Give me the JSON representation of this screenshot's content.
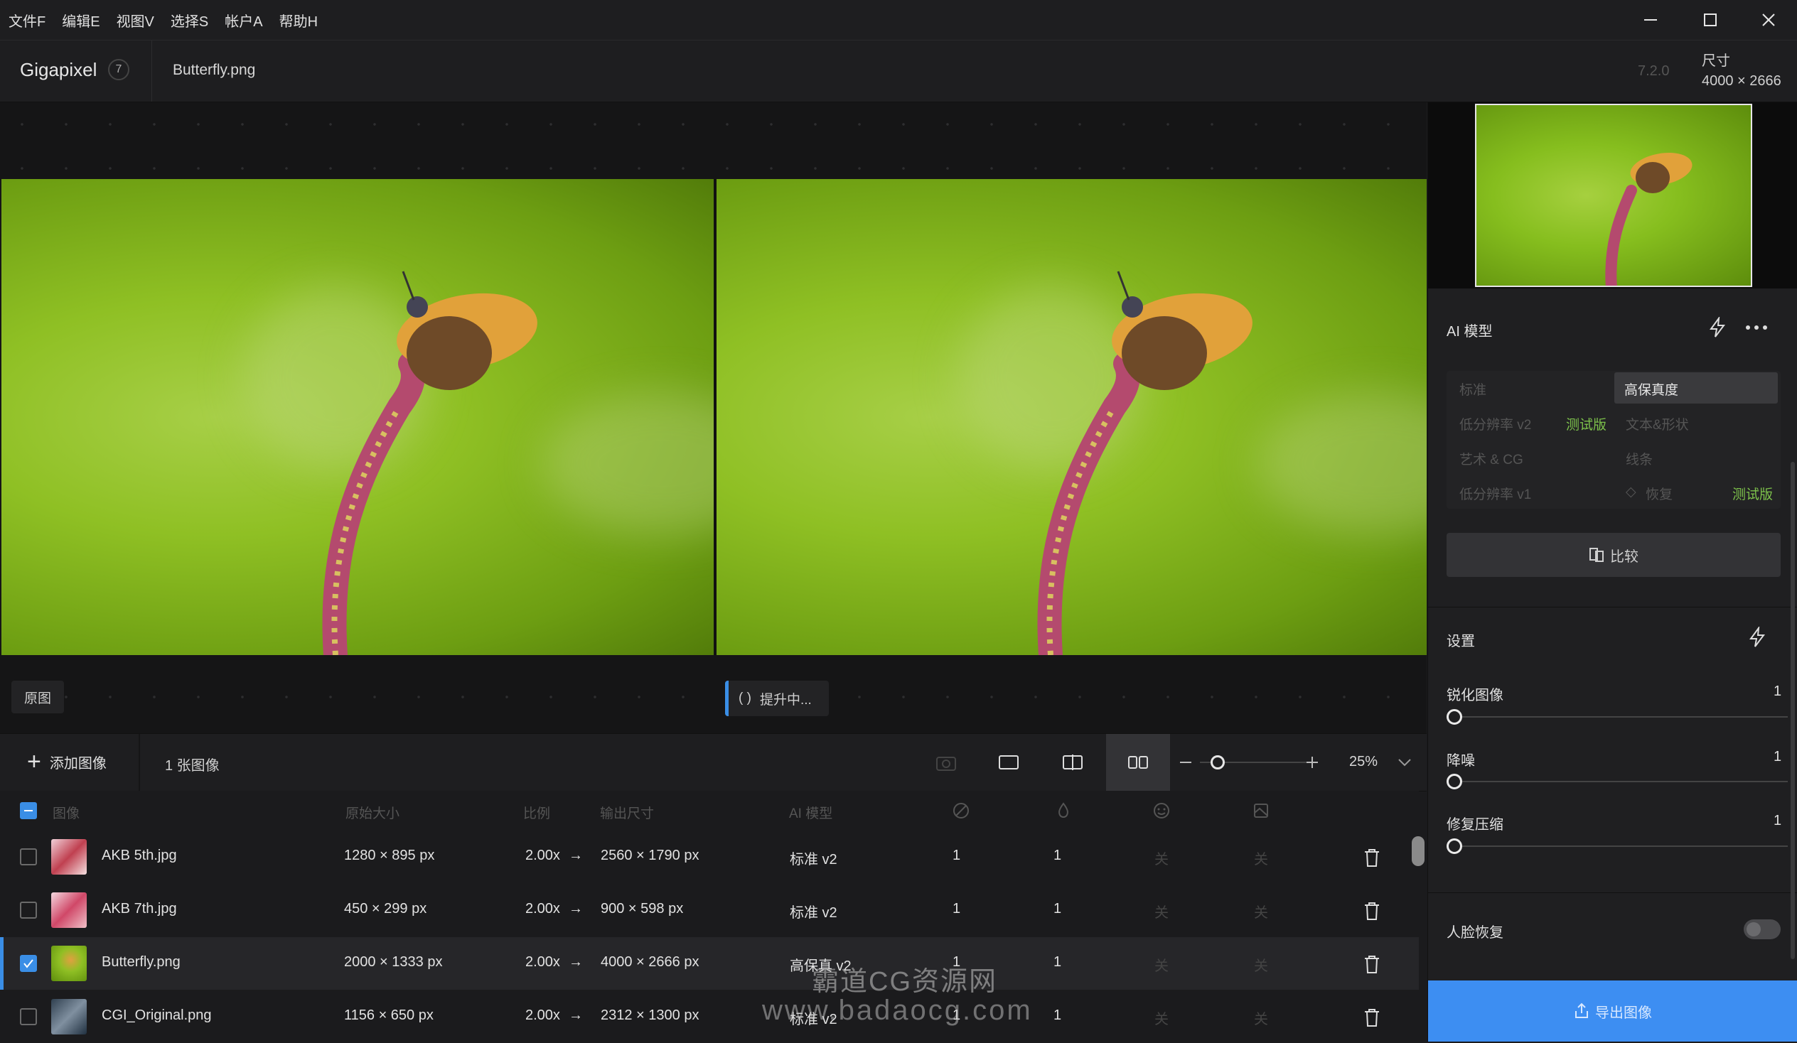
{
  "menubar": {
    "items": [
      "文件F",
      "编辑E",
      "视图V",
      "选择S",
      "帐户A",
      "帮助H"
    ]
  },
  "header": {
    "app_name": "Gigapixel",
    "badge": "7",
    "file_name": "Butterfly.png",
    "version": "7.2.0",
    "size_label": "尺寸",
    "size_value": "4000 × 2666"
  },
  "preview": {
    "original_label": "原图",
    "processing_label": "提升中..."
  },
  "toolbar": {
    "add_image": "添加图像",
    "image_count": "1 张图像",
    "zoom": "25%",
    "zoom_level": 0.1
  },
  "table": {
    "headers": {
      "image": "图像",
      "original_size": "原始大小",
      "scale": "比例",
      "output_size": "输出尺寸",
      "ai_model": "AI 模型"
    },
    "rows": [
      {
        "name": "AKB 5th.jpg",
        "original": "1280 × 895 px",
        "scale": "2.00x",
        "output": "2560 × 1790 px",
        "model": "标准 v2",
        "c1": "1",
        "c2": "1",
        "c3": "关",
        "c4": "关",
        "checked": false
      },
      {
        "name": "AKB 7th.jpg",
        "original": "450 × 299 px",
        "scale": "2.00x",
        "output": "900 × 598 px",
        "model": "标准 v2",
        "c1": "1",
        "c2": "1",
        "c3": "关",
        "c4": "关",
        "checked": false
      },
      {
        "name": "Butterfly.png",
        "original": "2000 × 1333 px",
        "scale": "2.00x",
        "output": "4000 × 2666 px",
        "model": "高保真 v2",
        "c1": "1",
        "c2": "1",
        "c3": "关",
        "c4": "关",
        "checked": true
      },
      {
        "name": "CGI_Original.png",
        "original": "1156 × 650 px",
        "scale": "2.00x",
        "output": "2312 × 1300 px",
        "model": "标准 v2",
        "c1": "1",
        "c2": "1",
        "c3": "关",
        "c4": "关",
        "checked": false
      }
    ]
  },
  "ai_panel": {
    "title": "AI 模型",
    "models": {
      "standard": "标准",
      "high_fidelity": "高保真度",
      "low_res_v2": "低分辨率 v2",
      "beta1": "测试版",
      "text_shape": "文本&形状",
      "art_cg": "艺术 & CG",
      "lines": "线条",
      "low_res_v1": "低分辨率 v1",
      "recovery": "恢复",
      "beta2": "测试版"
    },
    "compare": "比较"
  },
  "settings": {
    "title": "设置",
    "sharpen_label": "锐化图像",
    "sharpen_value": "1",
    "denoise_label": "降噪",
    "denoise_value": "1",
    "compression_label": "修复压缩",
    "compression_value": "1",
    "face_label": "人脸恢复",
    "export": "导出图像"
  },
  "watermark": {
    "line1": "霸道CG资源网",
    "line2": "www.badaocg.com"
  },
  "colors": {
    "accent": "#3a8ee6",
    "export": "#3d8ef2",
    "beta": "#7dc24b"
  }
}
